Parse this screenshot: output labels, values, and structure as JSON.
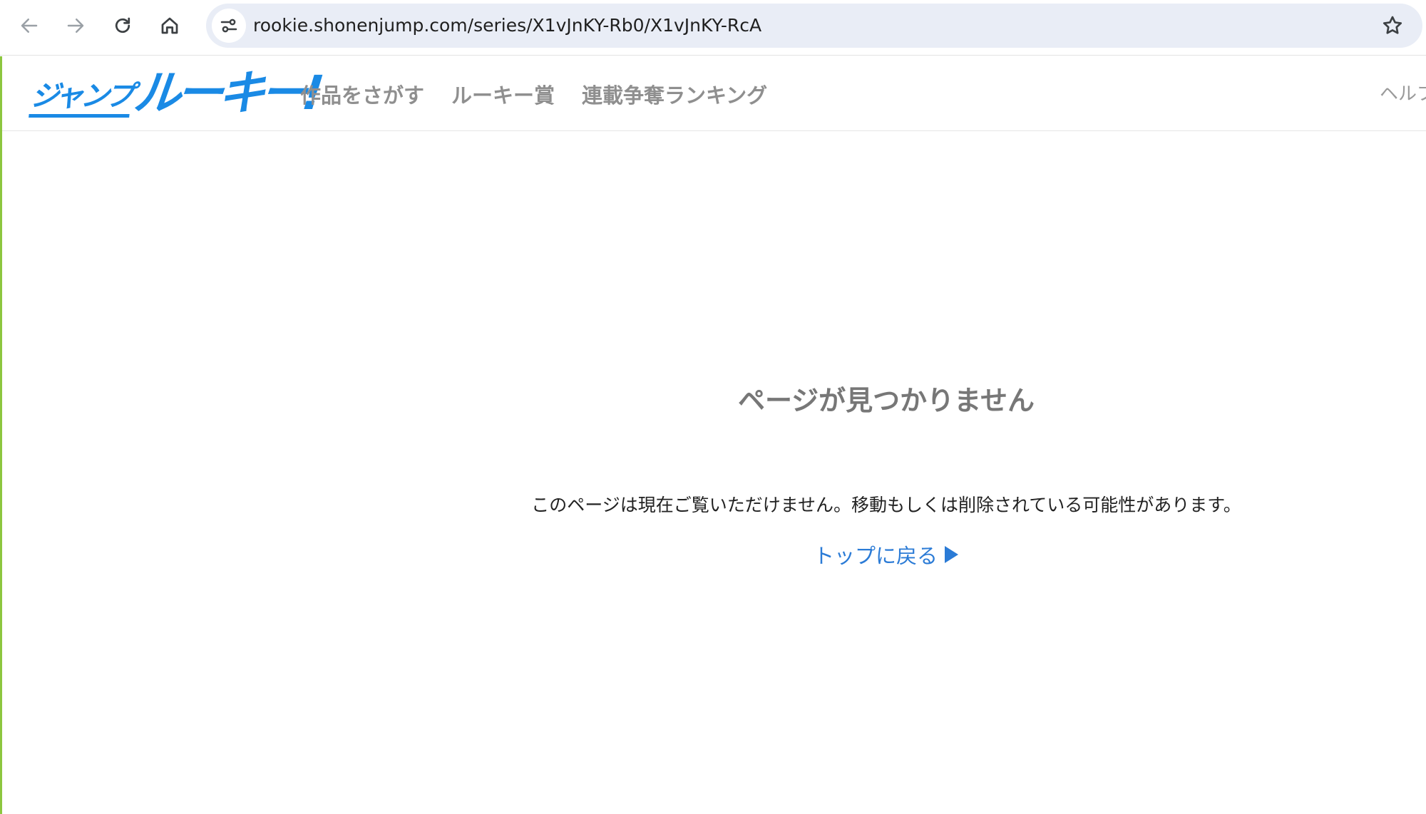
{
  "browser": {
    "url": "rookie.shonenjump.com/series/X1vJnKY-Rb0/X1vJnKY-RcA",
    "icons": {
      "back": "arrow-left-icon",
      "forward": "arrow-right-icon",
      "reload": "reload-icon",
      "home": "home-icon",
      "site_info": "tune-icon",
      "bookmark": "star-outline-icon"
    }
  },
  "site": {
    "logo_small": "ジャンプ",
    "logo_big": "ルーキー!",
    "brand_color": "#1a8ae5",
    "nav": [
      {
        "label": "作品をさがす"
      },
      {
        "label": "ルーキー賞"
      },
      {
        "label": "連載争奪ランキング"
      }
    ],
    "help_label": "ヘルプ"
  },
  "error": {
    "title": "ページが見つかりません",
    "message": "このページは現在ご覧いただけません。移動もしくは削除されている可能性があります。",
    "back_link": "トップに戻る",
    "link_color": "#2b7bd6"
  }
}
